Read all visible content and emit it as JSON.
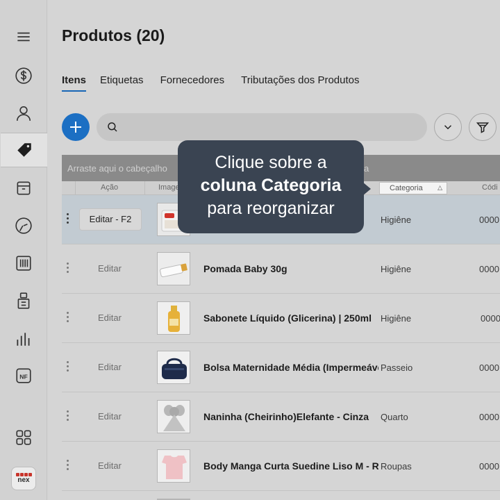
{
  "sidebar": {
    "items": [
      {
        "icon": "menu-icon"
      },
      {
        "icon": "dollar-icon"
      },
      {
        "icon": "user-icon"
      },
      {
        "icon": "tag-icon",
        "active": true
      },
      {
        "icon": "box-icon"
      },
      {
        "icon": "gauge-icon"
      },
      {
        "icon": "barcode-icon"
      },
      {
        "icon": "register-icon"
      },
      {
        "icon": "chart-icon"
      },
      {
        "icon": "nf-icon",
        "label": "NF"
      },
      {
        "icon": "apps-grid-icon"
      }
    ],
    "logo_text": "nex"
  },
  "page": {
    "title": "Produtos (20)",
    "tabs": [
      "Itens",
      "Etiquetas",
      "Fornecedores",
      "Tributações dos Produtos"
    ]
  },
  "search": {
    "placeholder": ""
  },
  "grid": {
    "group_hint_start": "Arraste aqui o cabeçalho",
    "group_hint_end": "a",
    "headers": {
      "action": "Ação",
      "image": "Image",
      "category": "Categoria",
      "code": "Códi"
    },
    "selected_edit_label": "Editar - F2",
    "rows": [
      {
        "edit": "Editar - F2",
        "name": "",
        "category": "Higiêne",
        "code": "0000"
      },
      {
        "edit": "Editar",
        "name": "Pomada Baby 30g",
        "category": "Higiêne",
        "code": "0000"
      },
      {
        "edit": "Editar",
        "name": "Sabonete Líquido (Glicerina) | 250ml",
        "category": "Higiêne",
        "code": "0000"
      },
      {
        "edit": "Editar",
        "name": "Bolsa Maternidade Média (Impermeável)",
        "category": "Passeio",
        "code": "0000"
      },
      {
        "edit": "Editar",
        "name": "Naninha (Cheirinho)Elefante - Cinza",
        "category": "Quarto",
        "code": "0000"
      },
      {
        "edit": "Editar",
        "name": "Body Manga Curta Suedine Liso M - Rosa",
        "category": "Roupas",
        "code": "0000"
      }
    ]
  },
  "tooltip": {
    "line1": "Clique sobre a",
    "line2": "coluna Categoria",
    "line3": "para reorganizar"
  },
  "colors": {
    "accent": "#1c6fc3",
    "tooltip_bg": "#3a4452",
    "brand_red": "#c8342b"
  }
}
